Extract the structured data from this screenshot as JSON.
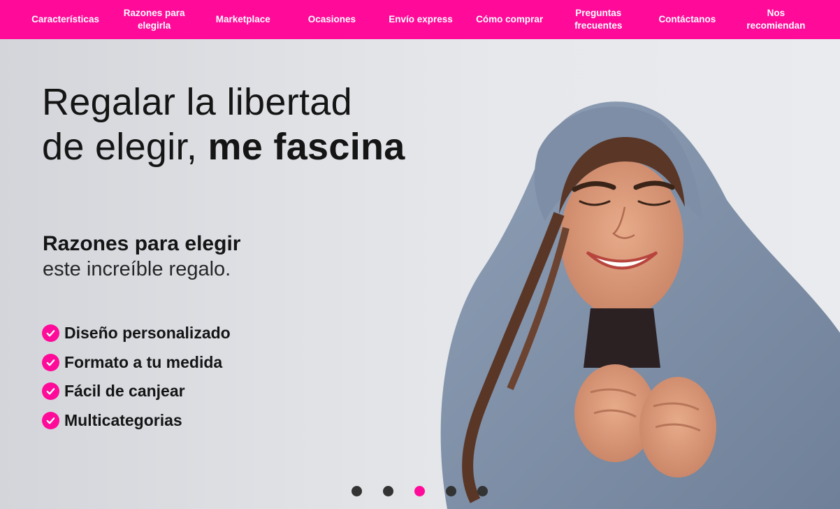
{
  "nav": {
    "items": [
      {
        "label": "Características"
      },
      {
        "label": "Razones para\nelegirla"
      },
      {
        "label": "Marketplace"
      },
      {
        "label": "Ocasiones"
      },
      {
        "label": "Envío express"
      },
      {
        "label": "Cómo comprar"
      },
      {
        "label": "Preguntas\nfrecuentes"
      },
      {
        "label": "Contáctanos"
      },
      {
        "label": "Nos\nrecomiendan"
      }
    ]
  },
  "hero": {
    "headline_light_1": "Regalar la libertad",
    "headline_light_2": "de elegir, ",
    "headline_bold": "me fascina",
    "subhead_bold": "Razones para elegir",
    "subhead_light": "este increíble regalo.",
    "features": [
      {
        "label": "Diseño personalizado"
      },
      {
        "label": "Formato a tu medida"
      },
      {
        "label": "Fácil de canjear"
      },
      {
        "label": "Multicategorias"
      }
    ],
    "check_icon": "check-circle-icon",
    "carousel": {
      "slide_count": 5,
      "active_index": 2
    }
  },
  "colors": {
    "brand_pink": "#ff0a99",
    "nav_text": "#ffffff",
    "text_dark": "#151515",
    "dot_inactive": "#333333"
  }
}
